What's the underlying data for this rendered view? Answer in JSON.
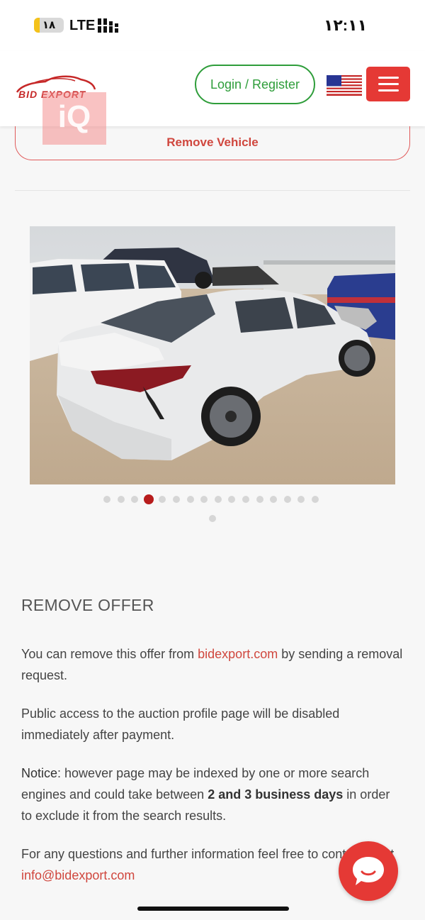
{
  "status_bar": {
    "battery_level": "١٨",
    "battery_fill_percent": 18,
    "network": "LTE",
    "time": "١٢:١١"
  },
  "header": {
    "logo_text": "BID EXPORT",
    "login_label": "Login / Register",
    "flag_icon": "us-flag-icon",
    "menu_icon": "hamburger-menu-icon"
  },
  "watermark": {
    "text": "iQ"
  },
  "vehicle": {
    "remove_label": "Remove Vehicle",
    "carousel": {
      "total_images": 17,
      "active_index": 3
    }
  },
  "remove_offer": {
    "heading": "REMOVE OFFER",
    "p1_prefix": "You can remove this offer from ",
    "p1_link": "bidexport.com",
    "p1_suffix": " by sending a removal request.",
    "p2": "Public access to the auction profile page will be disabled immediately after payment.",
    "p3_label": "Notice",
    "p3_text_a": ": however page may be indexed by one or more search engines and could take between ",
    "p3_bold": "2 and 3 business days",
    "p3_text_b": " in order to exclude it from the search results.",
    "p4_prefix": "For any questions and further information feel free to contact us at ",
    "p4_email": "info@bidexport.com"
  },
  "colors": {
    "brand_red": "#e53935",
    "login_green": "#2e9d3a",
    "link_red": "#d0473e"
  }
}
